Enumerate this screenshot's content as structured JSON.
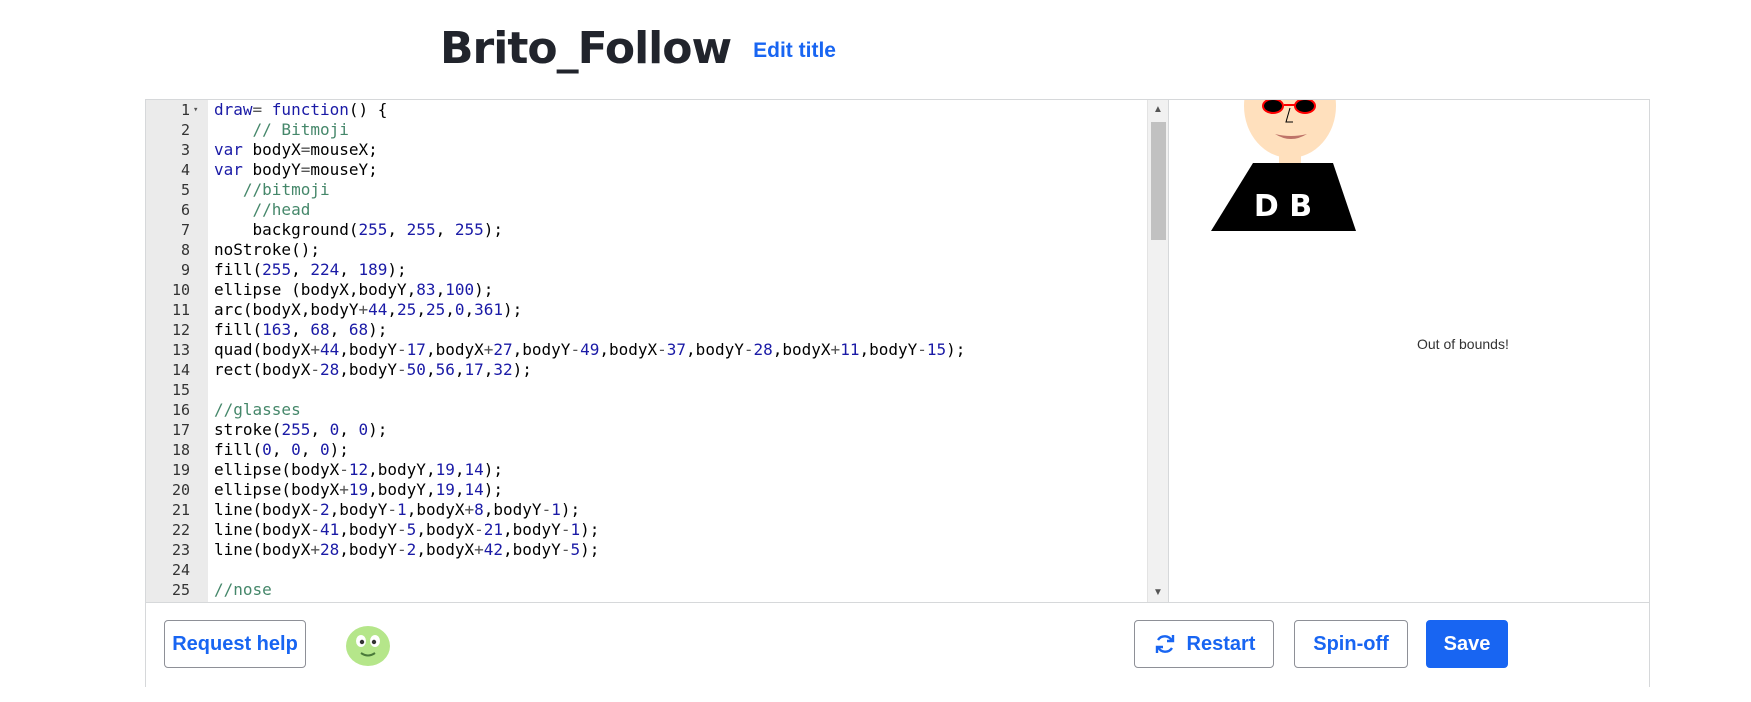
{
  "header": {
    "title": "Brito_Follow",
    "edit_title_label": "Edit title"
  },
  "editor": {
    "lines": [
      {
        "n": "1",
        "fold": true,
        "tokens": [
          [
            "k",
            "draw"
          ],
          [
            "op",
            "= "
          ],
          [
            "k",
            "function"
          ],
          [
            "t",
            "() {"
          ]
        ]
      },
      {
        "n": "2",
        "tokens": [
          [
            "t",
            "    "
          ],
          [
            "c",
            "// Bitmoji"
          ]
        ]
      },
      {
        "n": "3",
        "tokens": [
          [
            "k",
            "var"
          ],
          [
            "t",
            " bodyX"
          ],
          [
            "op",
            "="
          ],
          [
            "t",
            "mouseX;"
          ]
        ]
      },
      {
        "n": "4",
        "tokens": [
          [
            "k",
            "var"
          ],
          [
            "t",
            " bodyY"
          ],
          [
            "op",
            "="
          ],
          [
            "t",
            "mouseY;"
          ]
        ]
      },
      {
        "n": "5",
        "tokens": [
          [
            "t",
            "   "
          ],
          [
            "c",
            "//bitmoji"
          ]
        ]
      },
      {
        "n": "6",
        "tokens": [
          [
            "t",
            "    "
          ],
          [
            "c",
            "//head"
          ]
        ]
      },
      {
        "n": "7",
        "tokens": [
          [
            "t",
            "    background("
          ],
          [
            "n",
            "255"
          ],
          [
            "t",
            ", "
          ],
          [
            "n",
            "255"
          ],
          [
            "t",
            ", "
          ],
          [
            "n",
            "255"
          ],
          [
            "t",
            ");"
          ]
        ]
      },
      {
        "n": "8",
        "tokens": [
          [
            "t",
            "noStroke();"
          ]
        ]
      },
      {
        "n": "9",
        "tokens": [
          [
            "t",
            "fill("
          ],
          [
            "n",
            "255"
          ],
          [
            "t",
            ", "
          ],
          [
            "n",
            "224"
          ],
          [
            "t",
            ", "
          ],
          [
            "n",
            "189"
          ],
          [
            "t",
            ");"
          ]
        ]
      },
      {
        "n": "10",
        "tokens": [
          [
            "t",
            "ellipse (bodyX,bodyY,"
          ],
          [
            "n",
            "83"
          ],
          [
            "t",
            ","
          ],
          [
            "n",
            "100"
          ],
          [
            "t",
            ");"
          ]
        ]
      },
      {
        "n": "11",
        "tokens": [
          [
            "t",
            "arc(bodyX,bodyY"
          ],
          [
            "op",
            "+"
          ],
          [
            "n",
            "44"
          ],
          [
            "t",
            ","
          ],
          [
            "n",
            "25"
          ],
          [
            "t",
            ","
          ],
          [
            "n",
            "25"
          ],
          [
            "t",
            ","
          ],
          [
            "n",
            "0"
          ],
          [
            "t",
            ","
          ],
          [
            "n",
            "361"
          ],
          [
            "t",
            ");"
          ]
        ]
      },
      {
        "n": "12",
        "tokens": [
          [
            "t",
            "fill("
          ],
          [
            "n",
            "163"
          ],
          [
            "t",
            ", "
          ],
          [
            "n",
            "68"
          ],
          [
            "t",
            ", "
          ],
          [
            "n",
            "68"
          ],
          [
            "t",
            ");"
          ]
        ]
      },
      {
        "n": "13",
        "tokens": [
          [
            "t",
            "quad(bodyX"
          ],
          [
            "op",
            "+"
          ],
          [
            "n",
            "44"
          ],
          [
            "t",
            ",bodyY"
          ],
          [
            "op",
            "-"
          ],
          [
            "n",
            "17"
          ],
          [
            "t",
            ",bodyX"
          ],
          [
            "op",
            "+"
          ],
          [
            "n",
            "27"
          ],
          [
            "t",
            ",bodyY"
          ],
          [
            "op",
            "-"
          ],
          [
            "n",
            "49"
          ],
          [
            "t",
            ",bodyX"
          ],
          [
            "op",
            "-"
          ],
          [
            "n",
            "37"
          ],
          [
            "t",
            ",bodyY"
          ],
          [
            "op",
            "-"
          ],
          [
            "n",
            "28"
          ],
          [
            "t",
            ",bodyX"
          ],
          [
            "op",
            "+"
          ],
          [
            "n",
            "11"
          ],
          [
            "t",
            ",bodyY"
          ],
          [
            "op",
            "-"
          ],
          [
            "n",
            "15"
          ],
          [
            "t",
            ");"
          ]
        ]
      },
      {
        "n": "14",
        "tokens": [
          [
            "t",
            "rect(bodyX"
          ],
          [
            "op",
            "-"
          ],
          [
            "n",
            "28"
          ],
          [
            "t",
            ",bodyY"
          ],
          [
            "op",
            "-"
          ],
          [
            "n",
            "50"
          ],
          [
            "t",
            ","
          ],
          [
            "n",
            "56"
          ],
          [
            "t",
            ","
          ],
          [
            "n",
            "17"
          ],
          [
            "t",
            ","
          ],
          [
            "n",
            "32"
          ],
          [
            "t",
            ");"
          ]
        ]
      },
      {
        "n": "15",
        "tokens": []
      },
      {
        "n": "16",
        "tokens": [
          [
            "c",
            "//glasses"
          ]
        ]
      },
      {
        "n": "17",
        "tokens": [
          [
            "t",
            "stroke("
          ],
          [
            "n",
            "255"
          ],
          [
            "t",
            ", "
          ],
          [
            "n",
            "0"
          ],
          [
            "t",
            ", "
          ],
          [
            "n",
            "0"
          ],
          [
            "t",
            ");"
          ]
        ]
      },
      {
        "n": "18",
        "tokens": [
          [
            "t",
            "fill("
          ],
          [
            "n",
            "0"
          ],
          [
            "t",
            ", "
          ],
          [
            "n",
            "0"
          ],
          [
            "t",
            ", "
          ],
          [
            "n",
            "0"
          ],
          [
            "t",
            ");"
          ]
        ]
      },
      {
        "n": "19",
        "tokens": [
          [
            "t",
            "ellipse(bodyX"
          ],
          [
            "op",
            "-"
          ],
          [
            "n",
            "12"
          ],
          [
            "t",
            ",bodyY,"
          ],
          [
            "n",
            "19"
          ],
          [
            "t",
            ","
          ],
          [
            "n",
            "14"
          ],
          [
            "t",
            ");"
          ]
        ]
      },
      {
        "n": "20",
        "tokens": [
          [
            "t",
            "ellipse(bodyX"
          ],
          [
            "op",
            "+"
          ],
          [
            "n",
            "19"
          ],
          [
            "t",
            ",bodyY,"
          ],
          [
            "n",
            "19"
          ],
          [
            "t",
            ","
          ],
          [
            "n",
            "14"
          ],
          [
            "t",
            ");"
          ]
        ]
      },
      {
        "n": "21",
        "tokens": [
          [
            "t",
            "line(bodyX"
          ],
          [
            "op",
            "-"
          ],
          [
            "n",
            "2"
          ],
          [
            "t",
            ",bodyY"
          ],
          [
            "op",
            "-"
          ],
          [
            "n",
            "1"
          ],
          [
            "t",
            ",bodyX"
          ],
          [
            "op",
            "+"
          ],
          [
            "n",
            "8"
          ],
          [
            "t",
            ",bodyY"
          ],
          [
            "op",
            "-"
          ],
          [
            "n",
            "1"
          ],
          [
            "t",
            ");"
          ]
        ]
      },
      {
        "n": "22",
        "tokens": [
          [
            "t",
            "line(bodyX"
          ],
          [
            "op",
            "-"
          ],
          [
            "n",
            "41"
          ],
          [
            "t",
            ",bodyY"
          ],
          [
            "op",
            "-"
          ],
          [
            "n",
            "5"
          ],
          [
            "t",
            ",bodyX"
          ],
          [
            "op",
            "-"
          ],
          [
            "n",
            "21"
          ],
          [
            "t",
            ",bodyY"
          ],
          [
            "op",
            "-"
          ],
          [
            "n",
            "1"
          ],
          [
            "t",
            ");"
          ]
        ]
      },
      {
        "n": "23",
        "tokens": [
          [
            "t",
            "line(bodyX"
          ],
          [
            "op",
            "+"
          ],
          [
            "n",
            "28"
          ],
          [
            "t",
            ",bodyY"
          ],
          [
            "op",
            "-"
          ],
          [
            "n",
            "2"
          ],
          [
            "t",
            ",bodyX"
          ],
          [
            "op",
            "+"
          ],
          [
            "n",
            "42"
          ],
          [
            "t",
            ",bodyY"
          ],
          [
            "op",
            "-"
          ],
          [
            "n",
            "5"
          ],
          [
            "t",
            ");"
          ]
        ]
      },
      {
        "n": "24",
        "tokens": []
      },
      {
        "n": "25",
        "tokens": [
          [
            "c",
            "//nose"
          ]
        ]
      }
    ]
  },
  "output": {
    "shirt_text": "D B",
    "message": "Out of bounds!"
  },
  "toolbar": {
    "request_help_label": "Request help",
    "restart_label": "Restart",
    "spinoff_label": "Spin-off",
    "save_label": "Save"
  },
  "colors": {
    "accent": "#1865f2",
    "skin": "#ffe0bd",
    "glasses_stroke": "#ff0000",
    "mouth": "#a34444",
    "avatar_green": "#b5e68a"
  }
}
